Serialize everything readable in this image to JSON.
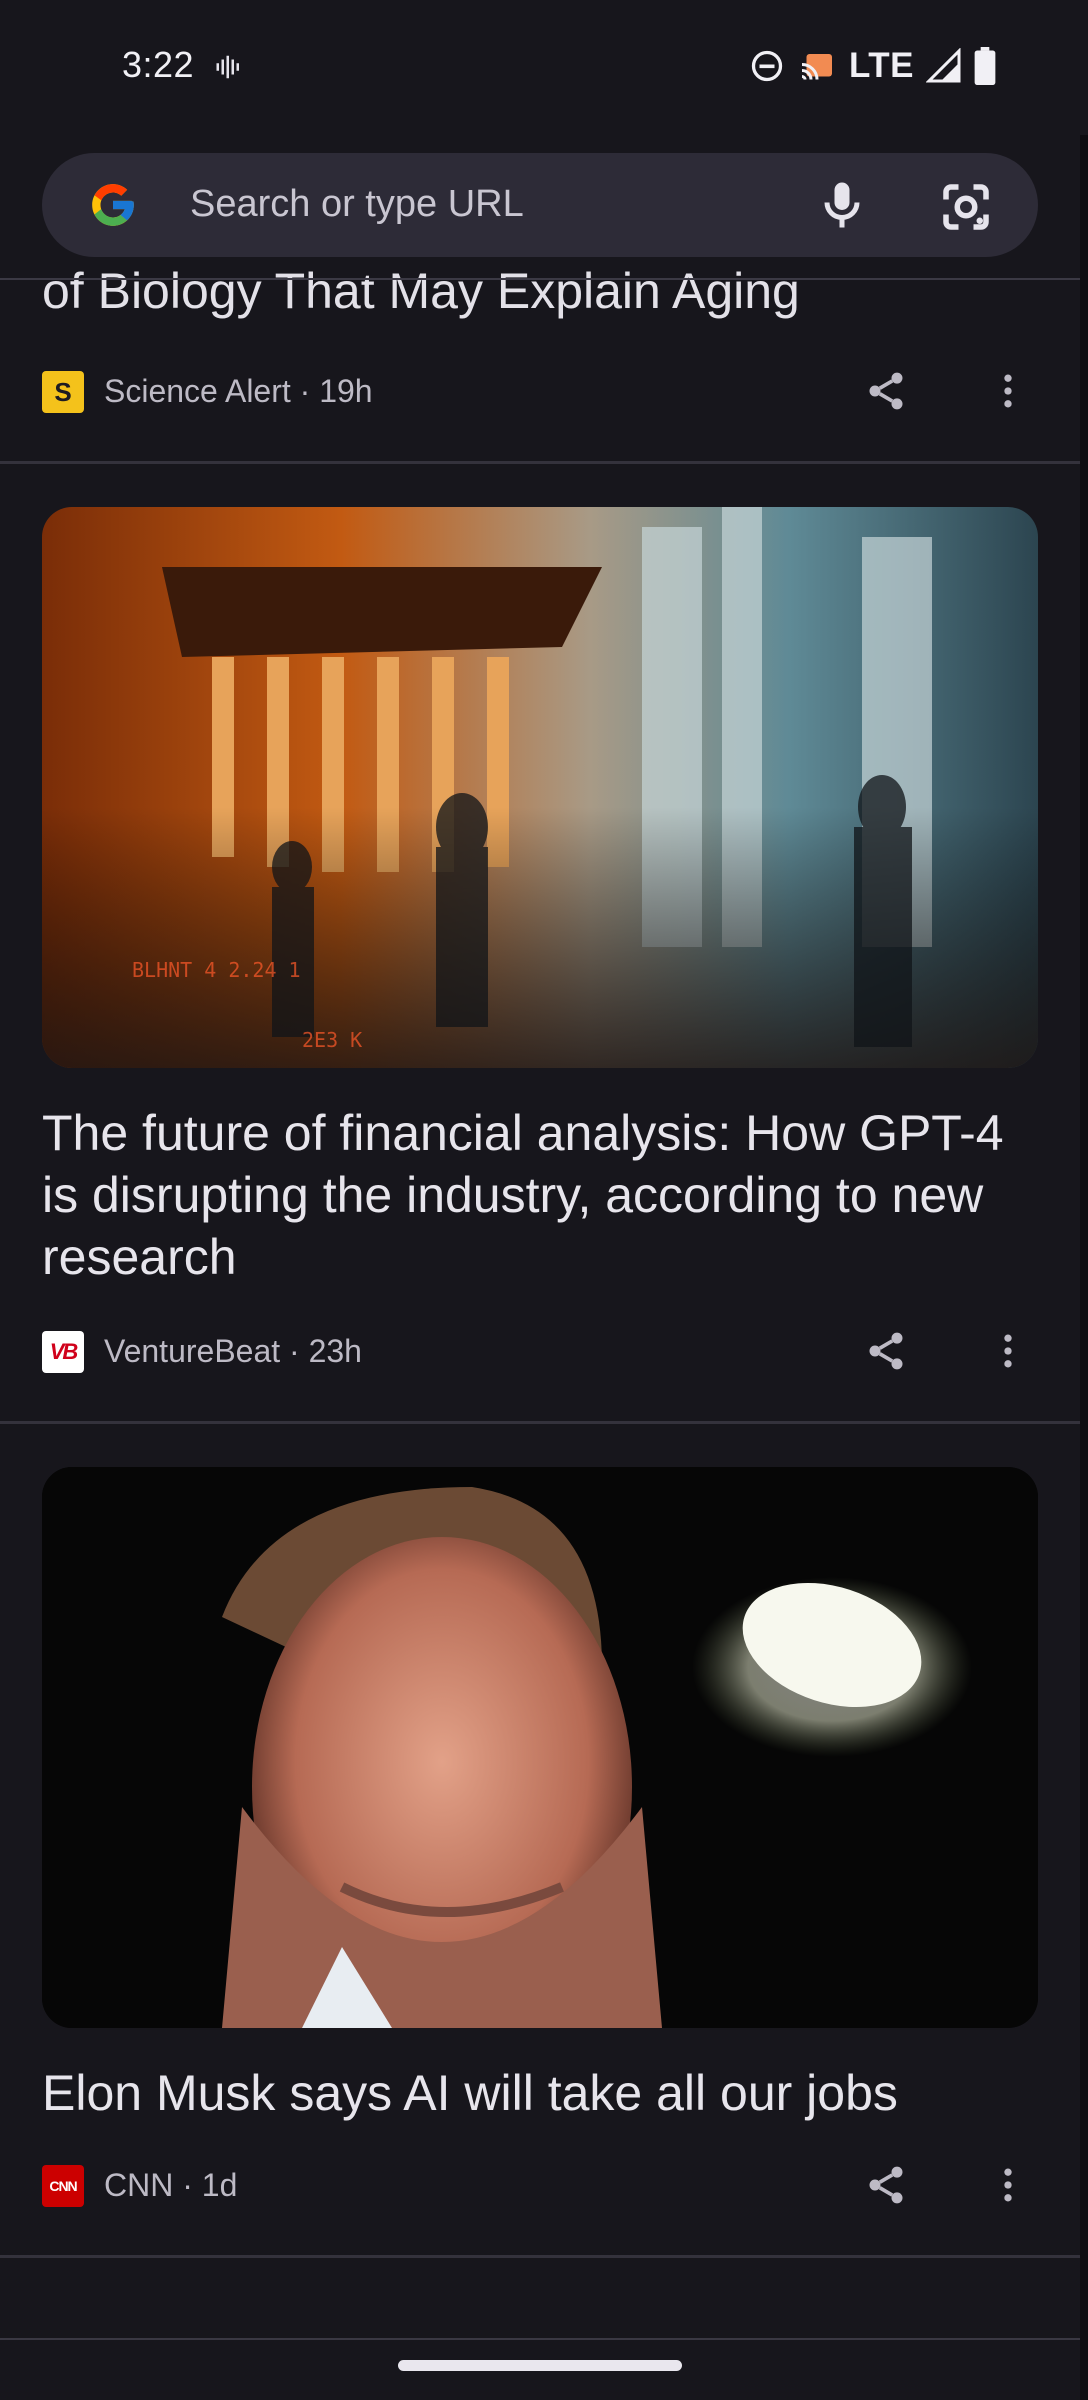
{
  "status_bar": {
    "time": "3:22",
    "network": "LTE",
    "icons": [
      "vibrate-icon",
      "do-not-disturb-icon",
      "cast-icon",
      "signal-icon",
      "battery-icon"
    ]
  },
  "search": {
    "placeholder": "Search or type URL",
    "icons": [
      "google-logo",
      "mic-icon",
      "lens-icon"
    ]
  },
  "feed": {
    "articles": [
      {
        "title": "of Biology That May Explain Aging",
        "source": "Science Alert",
        "age": "19h",
        "meta": "Science Alert · 19h",
        "icon_letter": "S",
        "icon_color": "#f4c21b"
      },
      {
        "title": "The future of financial analysis: How GPT-4 is disrupting the industry, according to new research",
        "source": "VentureBeat",
        "age": "23h",
        "meta": "VentureBeat · 23h",
        "icon_letter": "VB",
        "icon_color": "#ffffff"
      },
      {
        "title": "Elon Musk says AI will take all our jobs",
        "source": "CNN",
        "age": "1d",
        "meta": "CNN · 1d",
        "icon_letter": "CNN",
        "icon_color": "#cc0000"
      }
    ]
  },
  "colors": {
    "background": "#17161c",
    "search_bar": "#2d2b37",
    "text_primary": "#e7e5ec",
    "text_secondary": "#bdbac5"
  }
}
